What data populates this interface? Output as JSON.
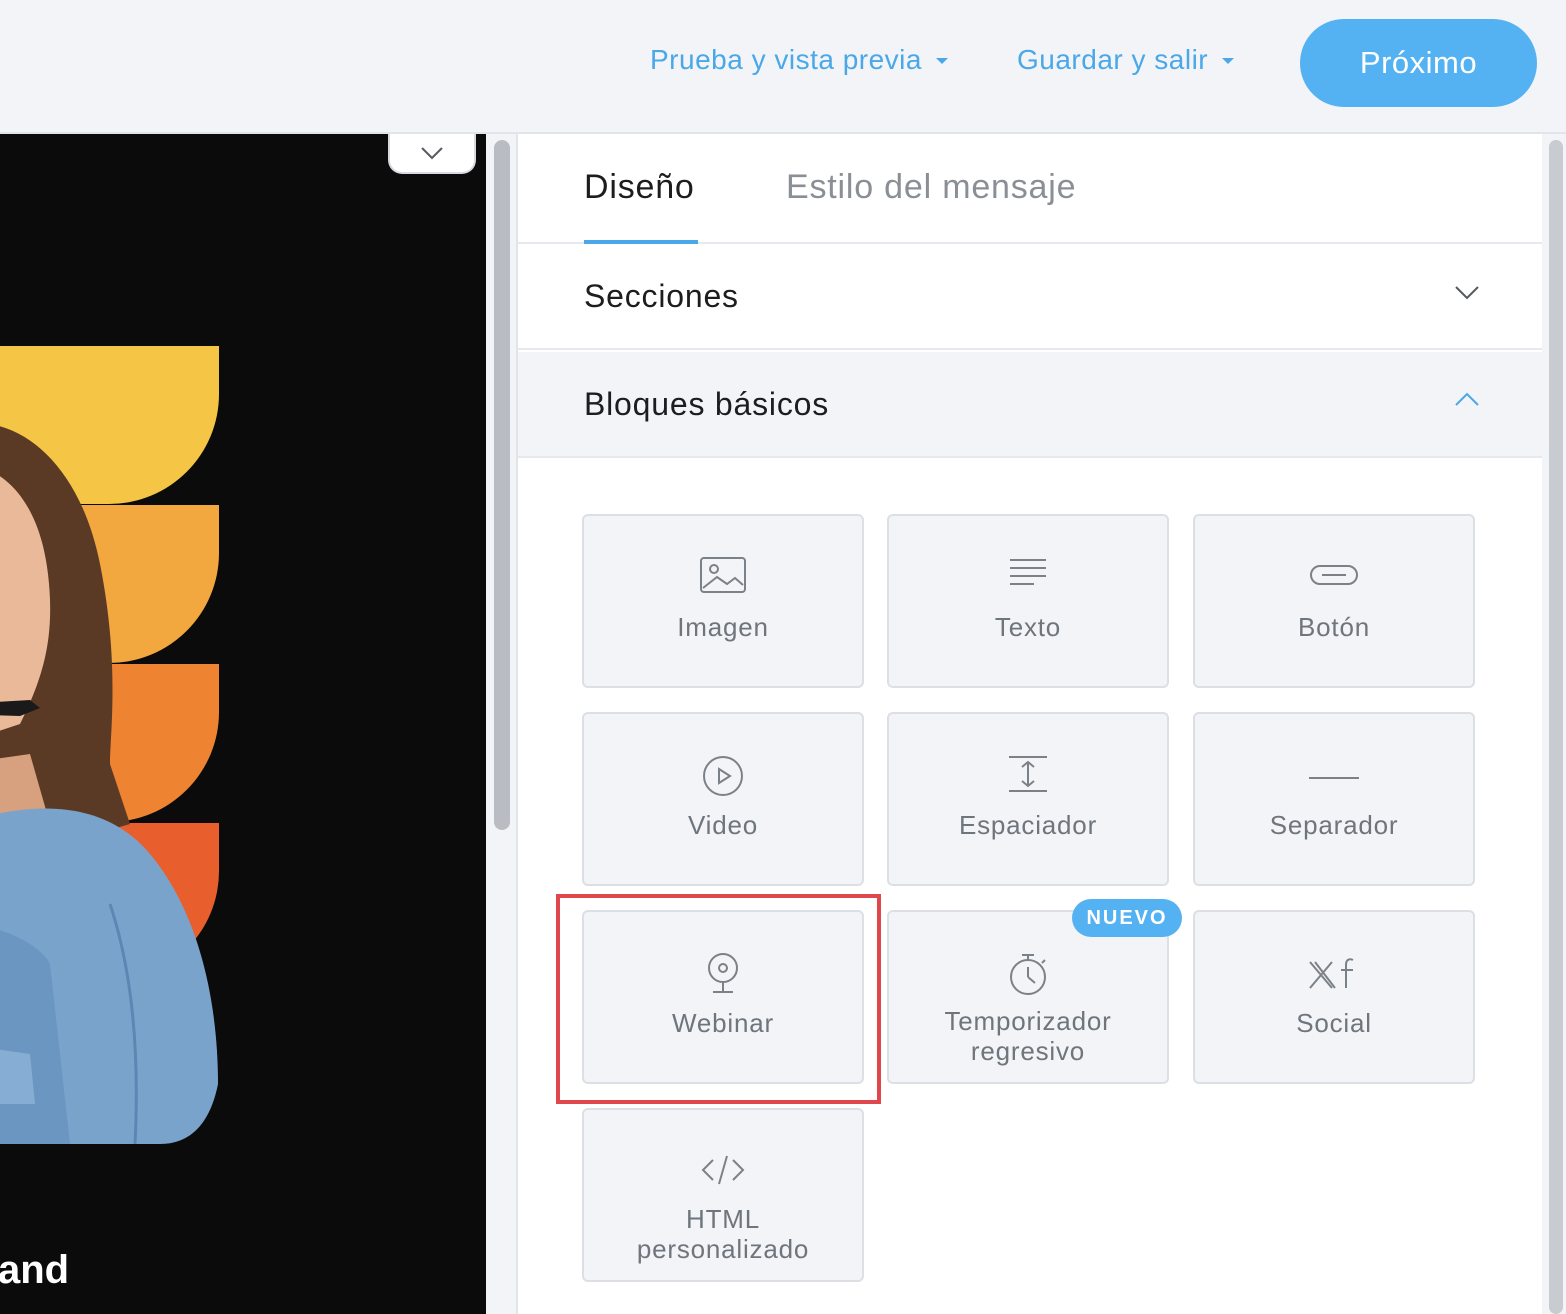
{
  "header": {
    "preview_label": "Prueba y vista previa",
    "save_label": "Guardar y salir",
    "next_label": "Próximo"
  },
  "preview": {
    "visible_text": "and"
  },
  "panel": {
    "tabs": [
      {
        "label": "Diseño",
        "active": true
      },
      {
        "label": "Estilo del mensaje",
        "active": false
      }
    ],
    "sections_label": "Secciones",
    "basic_blocks_label": "Bloques básicos",
    "blocks": [
      {
        "label": "Imagen",
        "icon": "image-icon"
      },
      {
        "label": "Texto",
        "icon": "text-icon"
      },
      {
        "label": "Botón",
        "icon": "button-icon"
      },
      {
        "label": "Video",
        "icon": "play-icon"
      },
      {
        "label": "Espaciador",
        "icon": "spacer-icon"
      },
      {
        "label": "Separador",
        "icon": "divider-icon"
      },
      {
        "label": "Webinar",
        "icon": "webcam-icon"
      },
      {
        "label_line1": "Temporizador",
        "label_line2": "regresivo",
        "icon": "stopwatch-icon",
        "badge": "NUEVO"
      },
      {
        "label": "Social",
        "icon": "social-icon"
      },
      {
        "label_line1": "HTML",
        "label_line2": "personalizado",
        "icon": "code-icon"
      }
    ]
  },
  "colors": {
    "accent": "#55b2f2",
    "link": "#4aa8e8",
    "highlight": "#e0474c"
  }
}
